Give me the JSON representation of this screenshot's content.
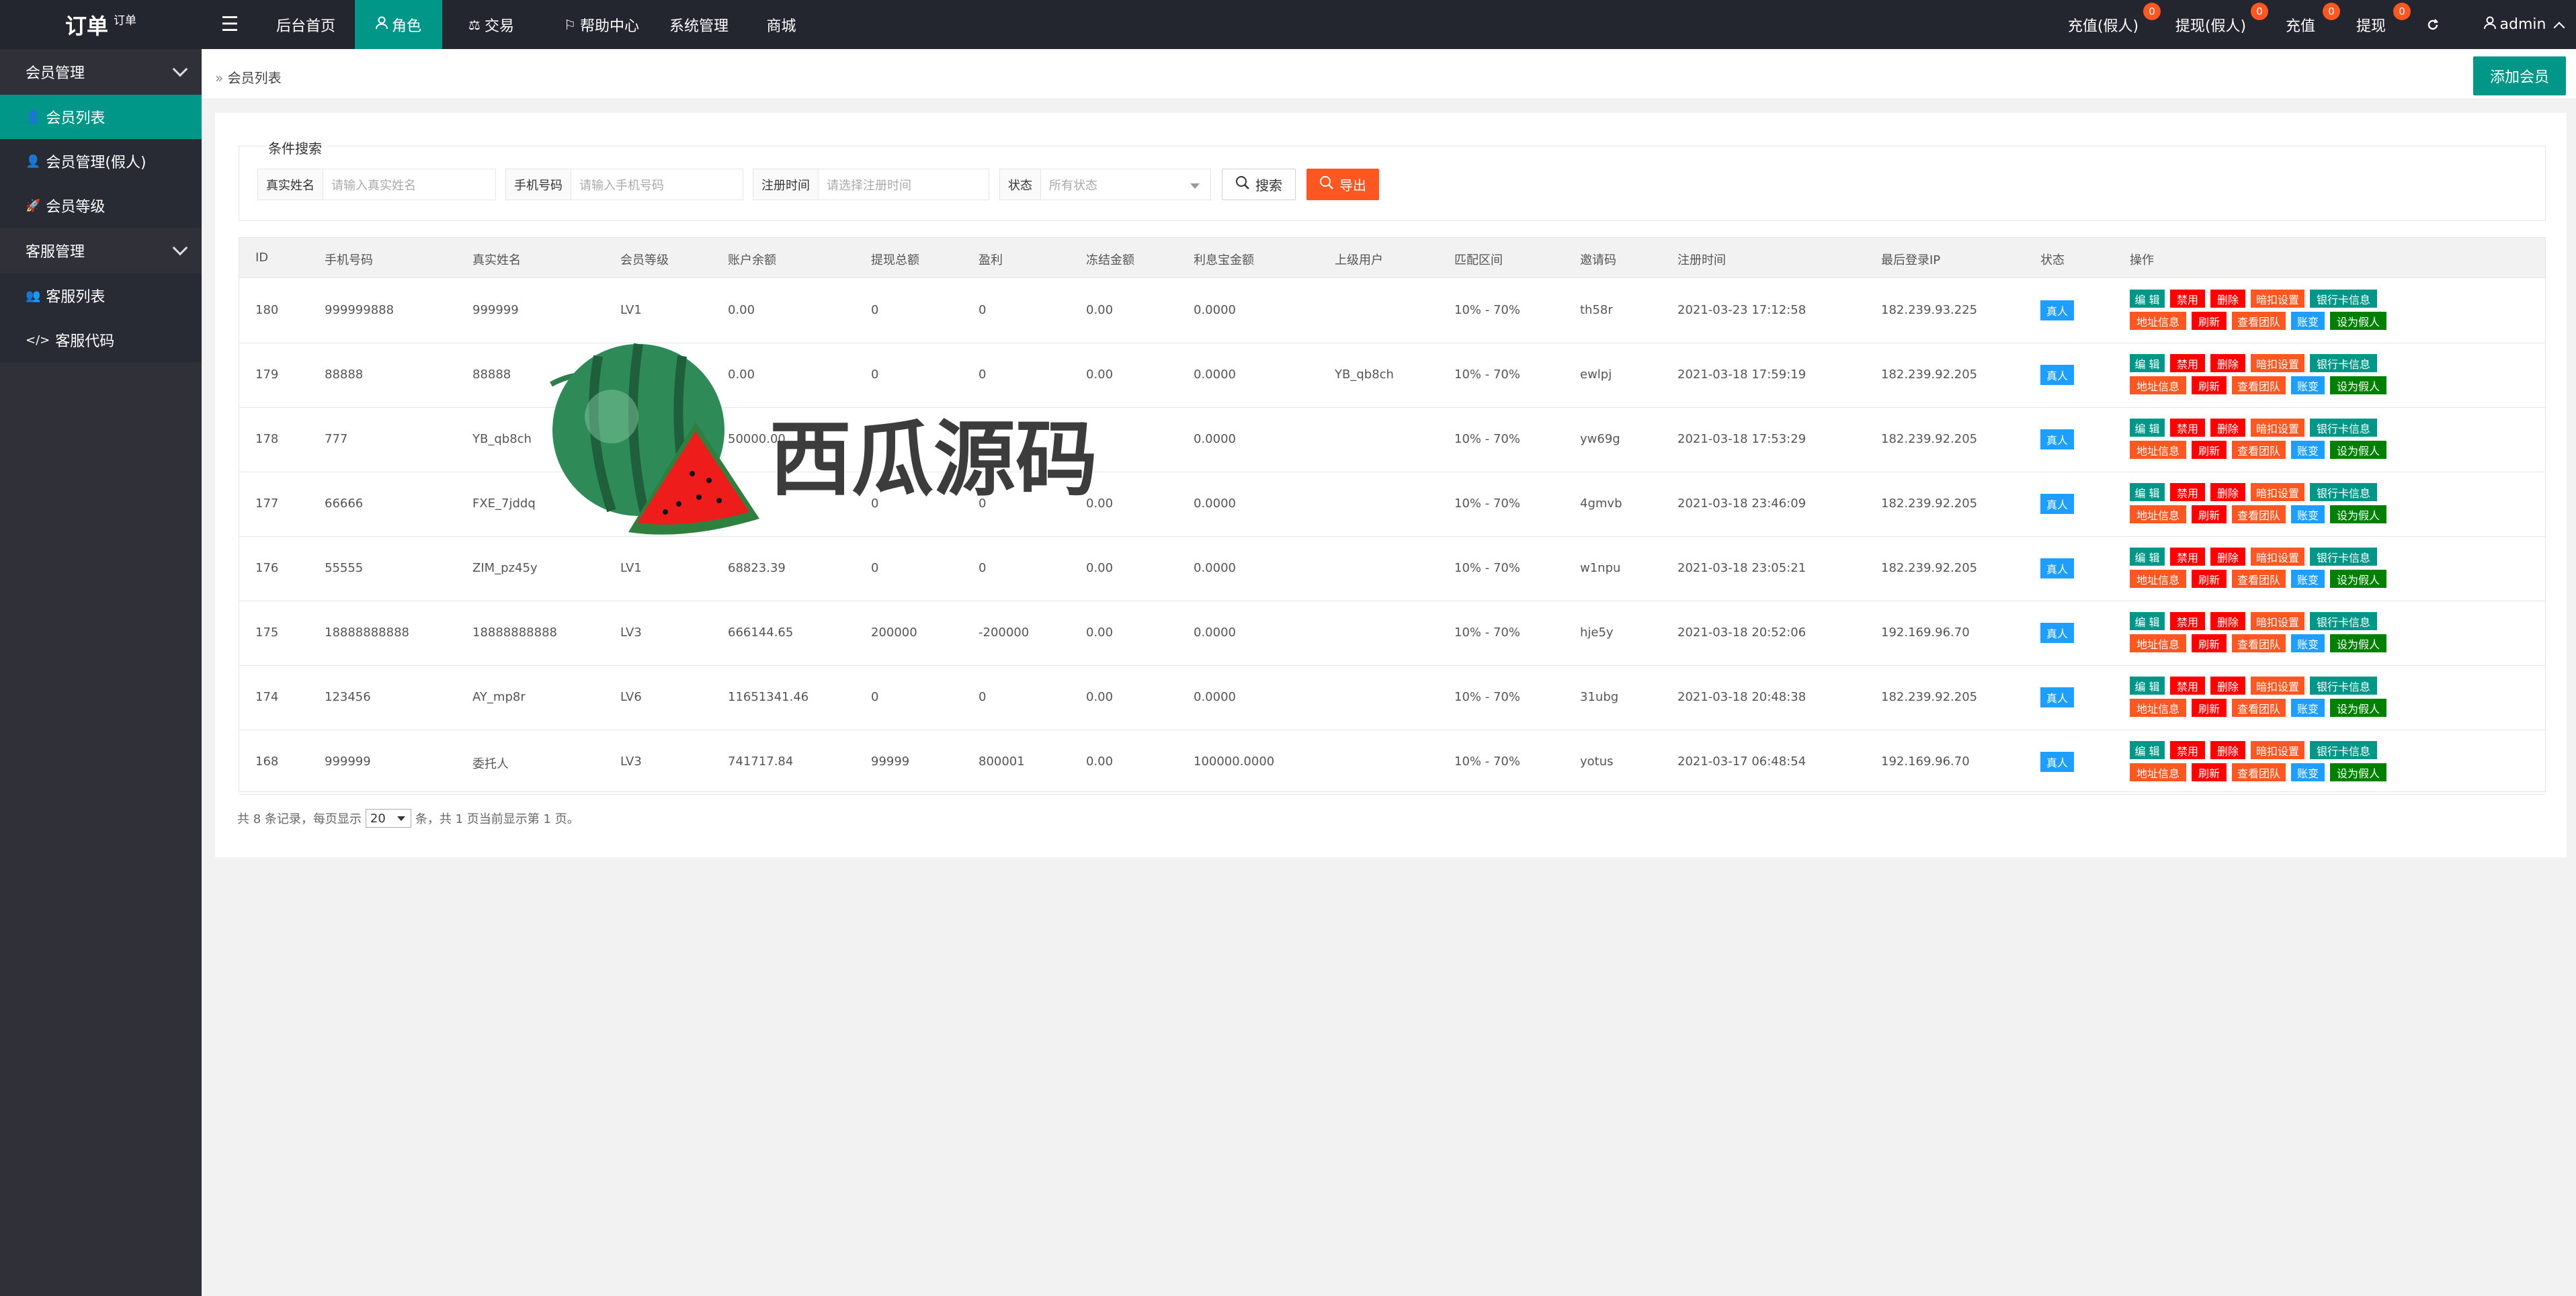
{
  "logo": {
    "main": "订单",
    "sub": "订单"
  },
  "topnav": [
    {
      "label": "后台首页",
      "icon": "none"
    },
    {
      "label": "角色",
      "icon": "user-icon",
      "active": true
    },
    {
      "label": "交易",
      "icon": "scale-icon"
    },
    {
      "label": "帮助中心",
      "icon": "flag-icon"
    },
    {
      "label": "系统管理",
      "icon": "none"
    },
    {
      "label": "商城",
      "icon": "none"
    }
  ],
  "rightnav": [
    {
      "label": "充值(假人)",
      "badge": "0"
    },
    {
      "label": "提现(假人)",
      "badge": "0"
    },
    {
      "label": "充值",
      "badge": "0"
    },
    {
      "label": "提现",
      "badge": "0"
    }
  ],
  "user": {
    "name": "admin"
  },
  "sidebar": {
    "group1": "会员管理",
    "items1": [
      {
        "label": "会员列表",
        "active": true
      },
      {
        "label": "会员管理(假人)"
      },
      {
        "label": "会员等级"
      }
    ],
    "group2": "客服管理",
    "items2": [
      {
        "label": "客服列表"
      },
      {
        "label": "客服代码"
      }
    ]
  },
  "breadcrumb": "会员列表",
  "add_button": "添加会员",
  "filter": {
    "title": "条件搜索",
    "name_label": "真实姓名",
    "name_placeholder": "请输入真实姓名",
    "phone_label": "手机号码",
    "phone_placeholder": "请输入手机号码",
    "date_label": "注册时间",
    "date_placeholder": "请选择注册时间",
    "status_label": "状态",
    "status_placeholder": "所有状态",
    "search": "搜索",
    "export": "导出"
  },
  "table": {
    "headers": [
      "ID",
      "手机号码",
      "真实姓名",
      "会员等级",
      "账户余额",
      "提现总额",
      "盈利",
      "冻结金额",
      "利息宝金额",
      "上级用户",
      "匹配区间",
      "邀请码",
      "注册时间",
      "最后登录IP",
      "状态",
      "操作"
    ],
    "status_label": "真人",
    "op_row1": [
      "编 辑",
      "禁用",
      "删除",
      "暗扣设置",
      "银行卡信息"
    ],
    "op_row2": [
      "地址信息",
      "刷新",
      "查看团队",
      "账变",
      "设为假人"
    ],
    "rows": [
      [
        "180",
        "999999888",
        "999999",
        "LV1",
        "0.00",
        "0",
        "0",
        "0.00",
        "0.0000",
        "",
        "10% - 70%",
        "th58r",
        "2021-03-23 17:12:58",
        "182.239.93.225"
      ],
      [
        "179",
        "88888",
        "88888",
        "",
        "0.00",
        "0",
        "0",
        "0.00",
        "0.0000",
        "YB_qb8ch",
        "10% - 70%",
        "ewlpj",
        "2021-03-18 17:59:19",
        "182.239.92.205"
      ],
      [
        "178",
        "777",
        "YB_qb8ch",
        "",
        "50000.00",
        "",
        "",
        "",
        "0.0000",
        "",
        "10% - 70%",
        "yw69g",
        "2021-03-18 17:53:29",
        "182.239.92.205"
      ],
      [
        "177",
        "66666",
        "FXE_7jddq",
        "",
        "",
        "0",
        "0",
        "0.00",
        "0.0000",
        "",
        "10% - 70%",
        "4gmvb",
        "2021-03-18 23:46:09",
        "182.239.92.205"
      ],
      [
        "176",
        "55555",
        "ZIM_pz45y",
        "LV1",
        "68823.39",
        "0",
        "0",
        "0.00",
        "0.0000",
        "",
        "10% - 70%",
        "w1npu",
        "2021-03-18 23:05:21",
        "182.239.92.205"
      ],
      [
        "175",
        "18888888888",
        "18888888888",
        "LV3",
        "666144.65",
        "200000",
        "-200000",
        "0.00",
        "0.0000",
        "",
        "10% - 70%",
        "hje5y",
        "2021-03-18 20:52:06",
        "192.169.96.70"
      ],
      [
        "174",
        "123456",
        "AY_mp8r",
        "LV6",
        "11651341.46",
        "0",
        "0",
        "0.00",
        "0.0000",
        "",
        "10% - 70%",
        "31ubg",
        "2021-03-18 20:48:38",
        "182.239.92.205"
      ],
      [
        "168",
        "999999",
        "委托人",
        "LV3",
        "741717.84",
        "99999",
        "800001",
        "0.00",
        "100000.0000",
        "",
        "10% - 70%",
        "yotus",
        "2021-03-17 06:48:54",
        "192.169.96.70"
      ]
    ]
  },
  "pager": {
    "prefix": "共 8 条记录，每页显示",
    "size": "20",
    "suffix": "条，共 1 页当前显示第 1 页。"
  },
  "watermark": "西瓜源码"
}
